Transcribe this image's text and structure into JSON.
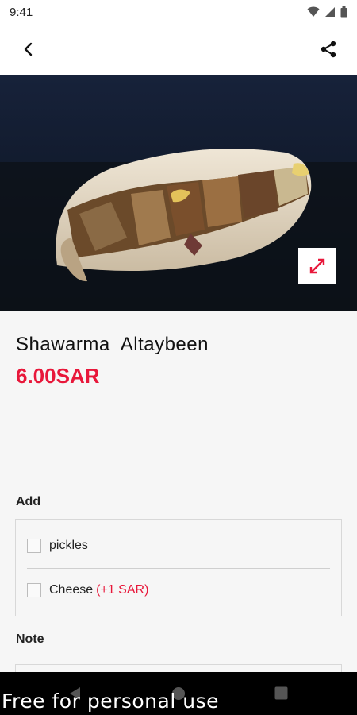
{
  "status_bar": {
    "time": "9:41"
  },
  "toolbar": {
    "back_icon": "back-arrow-icon",
    "share_icon": "share-icon"
  },
  "hero": {
    "image_alt": "shawarma sandwich photo",
    "expand_icon": "expand-icon"
  },
  "product": {
    "name": "Shawarma  Altaybeen",
    "price": "6.00SAR"
  },
  "add_section": {
    "label": "Add",
    "options": [
      {
        "label": "pickles",
        "extra": "",
        "checked": false
      },
      {
        "label": "Cheese",
        "extra": "(+1 SAR)",
        "checked": false
      }
    ]
  },
  "note_section": {
    "label": "Note"
  },
  "watermark": "Free for personal use",
  "colors": {
    "accent": "#e8173a",
    "text": "#1a1a1a",
    "background": "#f6f6f6"
  }
}
